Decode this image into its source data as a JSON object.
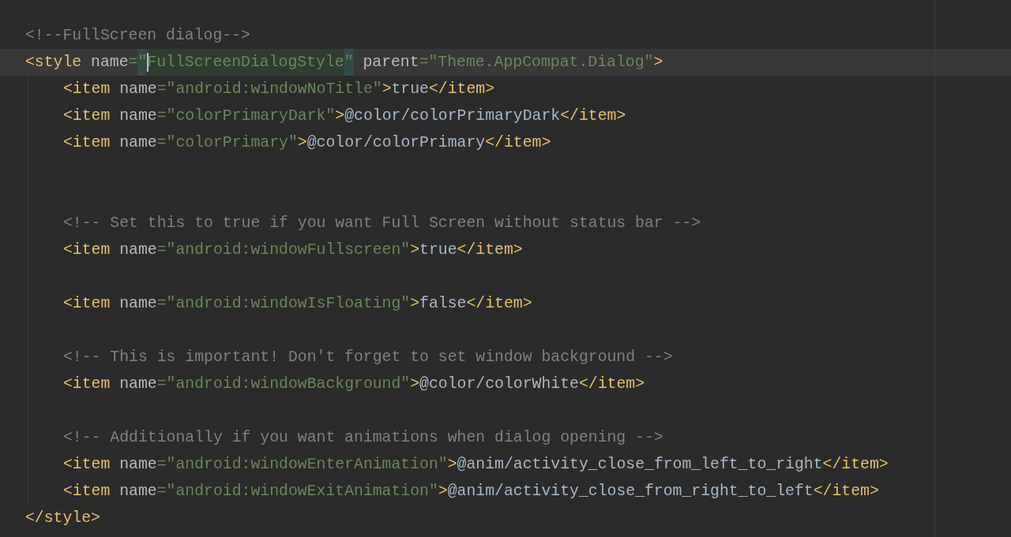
{
  "editor": {
    "lines": [
      {
        "current": false,
        "tokens": [
          {
            "kind": "comment",
            "text": "<!--FullScreen dialog-->"
          }
        ]
      },
      {
        "current": true,
        "tokens": [
          {
            "kind": "tag",
            "text": "<style"
          },
          {
            "kind": "attr",
            "text": " name"
          },
          {
            "kind": "punct",
            "text": "="
          },
          {
            "kind": "match",
            "text": "\""
          },
          {
            "kind": "match-caret",
            "text": "FullScreenDialogStyle"
          },
          {
            "kind": "match",
            "text": "\""
          },
          {
            "kind": "attr",
            "text": " parent"
          },
          {
            "kind": "punct",
            "text": "="
          },
          {
            "kind": "value",
            "text": "\"Theme.AppCompat.Dialog\""
          },
          {
            "kind": "tag",
            "text": ">"
          }
        ],
        "children": [
          {
            "current": false,
            "tokens": [
              {
                "kind": "tag",
                "text": "<item"
              },
              {
                "kind": "attr",
                "text": " name"
              },
              {
                "kind": "punct",
                "text": "="
              },
              {
                "kind": "value",
                "text": "\"android:windowNoTitle\""
              },
              {
                "kind": "tag",
                "text": ">"
              },
              {
                "kind": "text",
                "text": "true"
              },
              {
                "kind": "tag",
                "text": "</item>"
              }
            ]
          },
          {
            "current": false,
            "tokens": [
              {
                "kind": "tag",
                "text": "<item"
              },
              {
                "kind": "attr",
                "text": " name"
              },
              {
                "kind": "punct",
                "text": "="
              },
              {
                "kind": "value",
                "text": "\"colorPrimaryDark\""
              },
              {
                "kind": "tag",
                "text": ">"
              },
              {
                "kind": "text",
                "text": "@color/colorPrimaryDark"
              },
              {
                "kind": "tag",
                "text": "</item>"
              }
            ]
          },
          {
            "current": false,
            "tokens": [
              {
                "kind": "tag",
                "text": "<item"
              },
              {
                "kind": "attr",
                "text": " name"
              },
              {
                "kind": "punct",
                "text": "="
              },
              {
                "kind": "value",
                "text": "\"colorPrimary\""
              },
              {
                "kind": "tag",
                "text": ">"
              },
              {
                "kind": "text",
                "text": "@color/colorPrimary"
              },
              {
                "kind": "tag",
                "text": "</item>"
              }
            ]
          },
          {
            "current": false
          },
          {
            "current": false
          },
          {
            "current": false,
            "tokens": [
              {
                "kind": "comment",
                "text": "<!-- Set this to true if you want Full Screen without status bar -->"
              }
            ]
          },
          {
            "current": false,
            "tokens": [
              {
                "kind": "tag",
                "text": "<item"
              },
              {
                "kind": "attr",
                "text": " name"
              },
              {
                "kind": "punct",
                "text": "="
              },
              {
                "kind": "value",
                "text": "\"android:windowFullscreen\""
              },
              {
                "kind": "tag",
                "text": ">"
              },
              {
                "kind": "text",
                "text": "true"
              },
              {
                "kind": "tag",
                "text": "</item>"
              }
            ]
          },
          {
            "current": false
          },
          {
            "current": false,
            "tokens": [
              {
                "kind": "tag",
                "text": "<item"
              },
              {
                "kind": "attr",
                "text": " name"
              },
              {
                "kind": "punct",
                "text": "="
              },
              {
                "kind": "value",
                "text": "\"android:windowIsFloating\""
              },
              {
                "kind": "tag",
                "text": ">"
              },
              {
                "kind": "text",
                "text": "false"
              },
              {
                "kind": "tag",
                "text": "</item>"
              }
            ]
          },
          {
            "current": false
          },
          {
            "current": false,
            "tokens": [
              {
                "kind": "comment",
                "text": "<!-- This is important! Don't forget to set window background -->"
              }
            ]
          },
          {
            "current": false,
            "tokens": [
              {
                "kind": "tag",
                "text": "<item"
              },
              {
                "kind": "attr",
                "text": " name"
              },
              {
                "kind": "punct",
                "text": "="
              },
              {
                "kind": "value",
                "text": "\"android:windowBackground\""
              },
              {
                "kind": "tag",
                "text": ">"
              },
              {
                "kind": "text",
                "text": "@color/colorWhite"
              },
              {
                "kind": "tag",
                "text": "</item>"
              }
            ]
          },
          {
            "current": false
          },
          {
            "current": false,
            "tokens": [
              {
                "kind": "comment",
                "text": "<!-- Additionally if you want animations when dialog opening -->"
              }
            ]
          },
          {
            "current": false,
            "tokens": [
              {
                "kind": "tag",
                "text": "<item"
              },
              {
                "kind": "attr",
                "text": " name"
              },
              {
                "kind": "punct",
                "text": "="
              },
              {
                "kind": "value",
                "text": "\"android:windowEnterAnimation\""
              },
              {
                "kind": "tag",
                "text": ">"
              },
              {
                "kind": "text",
                "text": "@anim/activity_close_from_left_to_right"
              },
              {
                "kind": "tag",
                "text": "</item>"
              }
            ]
          },
          {
            "current": false,
            "tokens": [
              {
                "kind": "tag",
                "text": "<item"
              },
              {
                "kind": "attr",
                "text": " name"
              },
              {
                "kind": "punct",
                "text": "="
              },
              {
                "kind": "value",
                "text": "\"android:windowExitAnimation\""
              },
              {
                "kind": "tag",
                "text": ">"
              },
              {
                "kind": "text",
                "text": "@anim/activity_close_from_right_to_left"
              },
              {
                "kind": "tag",
                "text": "</item>"
              }
            ]
          }
        ]
      },
      {
        "current": false,
        "tokens": [
          {
            "kind": "tag",
            "text": "</style>"
          }
        ]
      }
    ]
  }
}
